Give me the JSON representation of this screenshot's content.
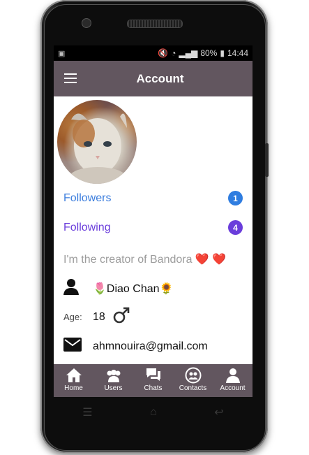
{
  "status_bar": {
    "battery": "80%",
    "time": "14:44"
  },
  "app_bar": {
    "title": "Account",
    "menu_icon": "hamburger-menu-icon"
  },
  "profile": {
    "avatar": "cat-avatar-image",
    "followers_label": "Followers",
    "followers_count": "1",
    "following_label": "Following",
    "following_count": "4",
    "bio": "I'm the creator of Bandora ❤️ ❤️",
    "name": "🌷Diao Chan🌻",
    "age_label": "Age:",
    "age": "18",
    "email": "ahmnouira@gmail.com"
  },
  "colors": {
    "appbar": "#62565f",
    "followers": "#3b7ddd",
    "followers_badge": "#2f7de0",
    "following": "#6a3ddb",
    "following_badge": "#6a3ddb"
  },
  "bottom_nav": [
    {
      "label": "Home",
      "icon": "home-icon"
    },
    {
      "label": "Users",
      "icon": "users-icon"
    },
    {
      "label": "Chats",
      "icon": "chats-icon"
    },
    {
      "label": "Contacts",
      "icon": "contacts-icon"
    },
    {
      "label": "Account",
      "icon": "account-icon"
    }
  ]
}
